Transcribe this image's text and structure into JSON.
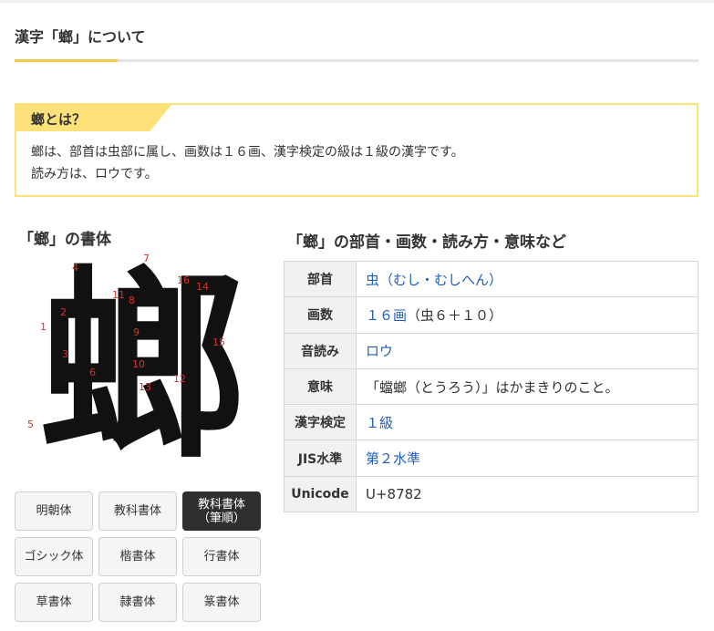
{
  "header": {
    "title": "漢字「螂」について"
  },
  "about": {
    "title": "螂とは？",
    "line1": "螂は、部首は虫部に属し、画数は１６画、漢字検定の級は１級の漢字です。",
    "line2": "読み方は、ロウです。"
  },
  "shotai": {
    "title": "「螂」の書体",
    "kanji": "螂",
    "stroke_numbers": [
      "1",
      "2",
      "3",
      "4",
      "5",
      "6",
      "7",
      "8",
      "9",
      "10",
      "11",
      "12",
      "13",
      "14",
      "15",
      "16"
    ]
  },
  "fonts": [
    {
      "label": "明朝体",
      "active": false
    },
    {
      "label": "教科書体",
      "active": false
    },
    {
      "label": "教科書体\n（筆順）",
      "active": true
    },
    {
      "label": "ゴシック体",
      "active": false
    },
    {
      "label": "楷書体",
      "active": false
    },
    {
      "label": "行書体",
      "active": false
    },
    {
      "label": "草書体",
      "active": false
    },
    {
      "label": "隷書体",
      "active": false
    },
    {
      "label": "篆書体",
      "active": false
    }
  ],
  "table": {
    "title": "「螂」の部首・画数・読み方・意味など",
    "rows": {
      "bushu": {
        "label": "部首",
        "link": "虫（むし・むしへん）"
      },
      "kakusu": {
        "label": "画数",
        "link": "１６画",
        "extra": "（虫６＋１０）"
      },
      "onyomi": {
        "label": "音読み",
        "link": "ロウ"
      },
      "imi": {
        "label": "意味",
        "text": "「蟷螂（とうろう）」はかまきりのこと。"
      },
      "kanken": {
        "label": "漢字検定",
        "link": "１級"
      },
      "jis": {
        "label": "JIS水準",
        "link": "第２水準"
      },
      "unicode": {
        "label": "Unicode",
        "text": "U+8782"
      }
    }
  },
  "colors": {
    "accent_yellow": "#fde27a",
    "underline_yellow": "#f2c94c",
    "link_blue": "#1f5fbf",
    "stroke_red": "#d9312b",
    "active_button": "#2f2f2f"
  }
}
